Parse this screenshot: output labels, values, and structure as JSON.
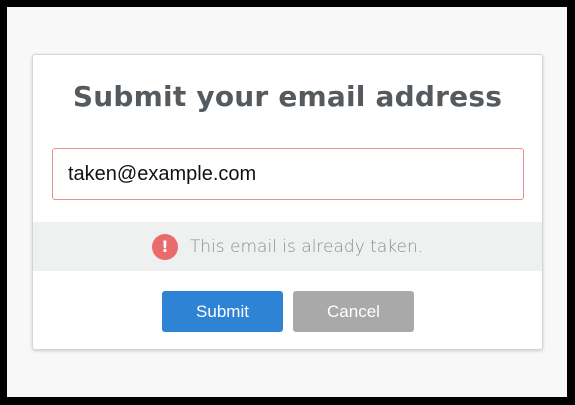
{
  "dialog": {
    "title": "Submit your email address",
    "email_input": {
      "value": "taken@example.com",
      "placeholder": ""
    },
    "error": {
      "icon": "exclamation-circle-icon",
      "icon_glyph": "!",
      "message": "This email is already taken."
    },
    "buttons": {
      "submit_label": "Submit",
      "cancel_label": "Cancel"
    }
  },
  "colors": {
    "submit": "#2f83d4",
    "cancel": "#a9a9a9",
    "error_icon": "#ea6b6b",
    "error_border": "#e39595"
  }
}
